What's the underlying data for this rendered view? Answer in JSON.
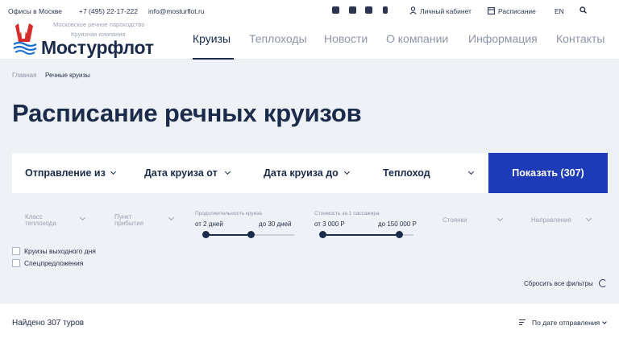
{
  "topbar": {
    "offices": "Офисы в Москве",
    "phone": "+7 (495) 22-17-222",
    "email": "info@mosturflot.ru",
    "account": "Личный кабинет",
    "schedule": "Расписание",
    "lang": "EN"
  },
  "logo": {
    "line1": "Московское речное пароходство",
    "line2": "Круизная компания",
    "name": "Мостурфлот"
  },
  "nav": [
    "Круизы",
    "Теплоходы",
    "Новости",
    "О компании",
    "Информация",
    "Контакты"
  ],
  "breadcrumb": [
    "Главная",
    "Речные круизы"
  ],
  "page_title": "Расписание речных круизов",
  "filters": {
    "departure": "Отправление из",
    "date_from": "Дата круиза от",
    "date_to": "Дата круиза до",
    "ship": "Теплоход",
    "show_button": "Показать (307)"
  },
  "secondary_filters": {
    "ship_class_l1": "Класс",
    "ship_class_l2": "теплохода",
    "arrival_l1": "Пункт",
    "arrival_l2": "прибытия",
    "duration_label": "Продолжительность круиза",
    "duration_from": "от 2 дней",
    "duration_to": "до 30 дней",
    "duration_min": 2,
    "duration_max": 30,
    "price_label": "Стоимость за 1 пассажира",
    "price_from": "от 3 000 Р",
    "price_to": "до 150 000 Р",
    "price_min": 3000,
    "price_max": 150000,
    "stops": "Стоянки",
    "directions": "Направления"
  },
  "checkboxes": [
    "Круизы выходного дня",
    "Спецпредложения"
  ],
  "reset": "Сбросить все фильтры",
  "results": {
    "found": "Найдено 307 туров",
    "sort": "По дате отправления"
  },
  "colors": {
    "accent": "#1d3bb8",
    "navy": "#1b2b4b",
    "background": "#eef1f6",
    "logo_red": "#d62b2b"
  },
  "icons": [
    "vk-icon",
    "telegram-icon",
    "youtube-icon",
    "odnoklassniki-icon",
    "user-icon",
    "calendar-icon",
    "search-icon",
    "chevron-down-icon",
    "refresh-icon",
    "sort-icon"
  ]
}
